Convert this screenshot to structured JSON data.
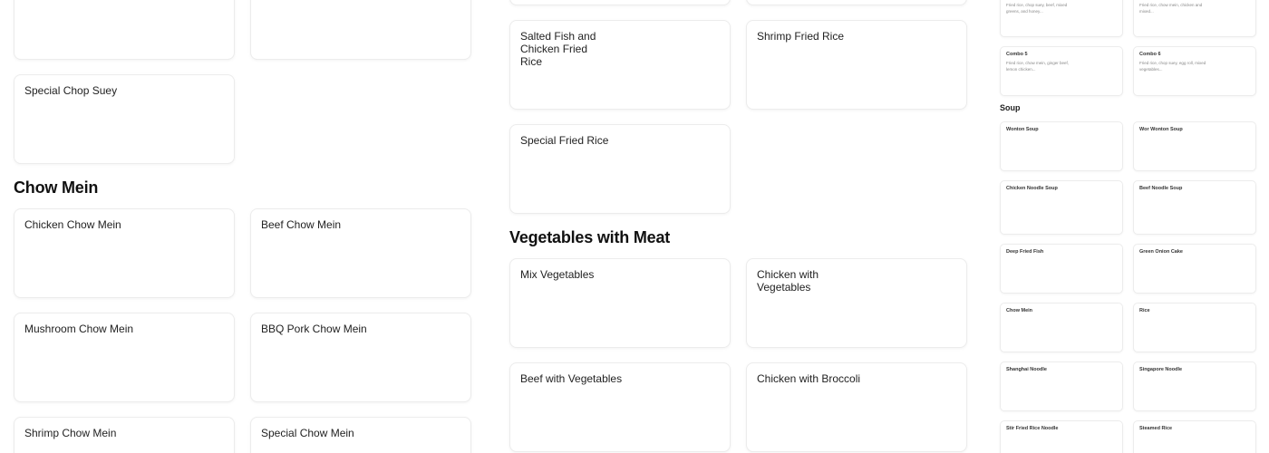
{
  "col1": {
    "top_cards": [],
    "special_chop_suey": "Special Chop Suey",
    "chow_mein_heading": "Chow Mein",
    "items": [
      "Chicken Chow Mein",
      "Beef Chow Mein",
      "Mushroom Chow Mein",
      "BBQ Pork Chow Mein",
      "Shrimp Chow Mein",
      "Special Chow Mein"
    ]
  },
  "col2": {
    "salted_fish": "Salted Fish and Chicken Fried Rice",
    "shrimp_fried_rice": "Shrimp Fried Rice",
    "special_fried_rice": "Special Fried Rice",
    "veg_meat_heading": "Vegetables with Meat",
    "items": [
      "Mix Vegetables",
      "Chicken with Vegetables",
      "Beef with Vegetables",
      "Chicken with Broccoli"
    ]
  },
  "side": {
    "top_desc_left": "Fried rice, chop suey, beef, mixed greens, and honey...",
    "top_desc_right": "Fried rice, chow mein, chicken and mixed...",
    "combo5": {
      "title": "Combo 5",
      "desc": "Fried rice, chow mein, ginger beef, lemon chicken..."
    },
    "combo6": {
      "title": "Combo 6",
      "desc": "Fried rice, chop suey, egg roll, mixed vegetables..."
    },
    "soup_heading": "Soup",
    "items": [
      "Wonton Soup",
      "Wor Wonton Soup",
      "Chicken Noodle Soup",
      "Beef Noodle Soup",
      "Deep Fried Fish",
      "Green Onion Cake",
      "Chow Mein",
      "Rice",
      "Shanghai Noodle",
      "Singapore Noodle",
      "Stir Fried Rice Noodle",
      "Steamed Rice"
    ]
  }
}
